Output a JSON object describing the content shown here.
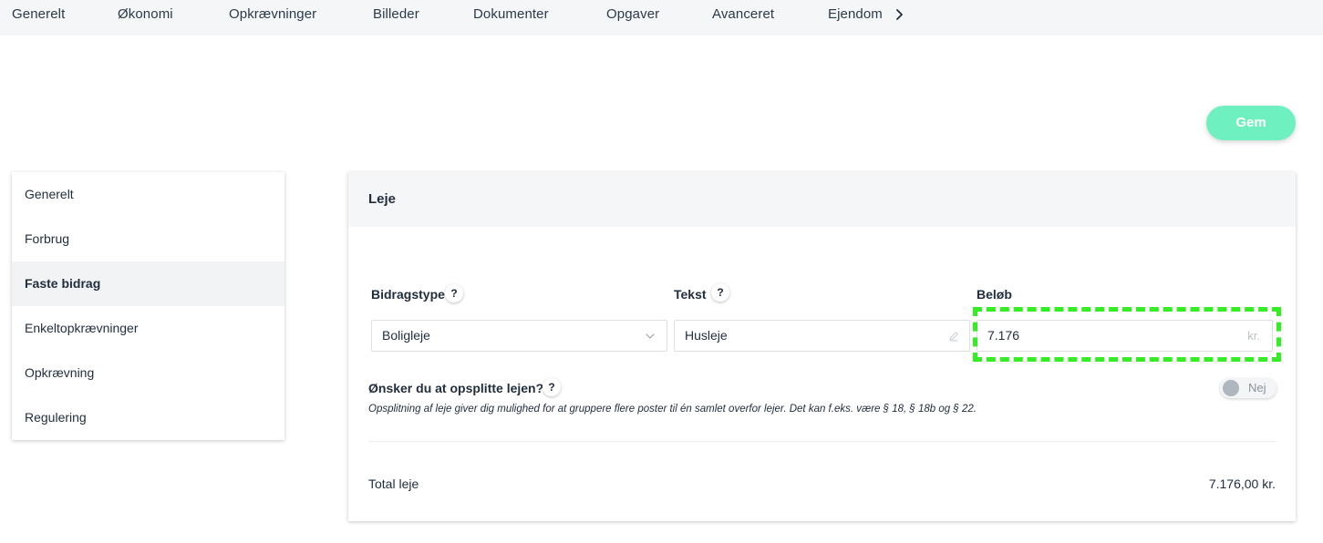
{
  "topnav": {
    "tabs": [
      "Generelt",
      "Økonomi",
      "Opkrævninger",
      "Billeder",
      "Dokumenter",
      "Opgaver",
      "Avanceret",
      "Ejendom"
    ],
    "more_icon": "chevron-right-icon"
  },
  "save_button": {
    "label": "Gem",
    "color": "#6ff0c0"
  },
  "sidebar": {
    "items": [
      {
        "label": "Generelt",
        "active": false
      },
      {
        "label": "Forbrug",
        "active": false
      },
      {
        "label": "Faste bidrag",
        "active": true
      },
      {
        "label": "Enkeltopkrævninger",
        "active": false
      },
      {
        "label": "Opkrævning",
        "active": false
      },
      {
        "label": "Regulering",
        "active": false
      }
    ]
  },
  "card": {
    "title": "Leje",
    "fields": {
      "type": {
        "label": "Bidragstype",
        "help": "?",
        "value": "Boligleje"
      },
      "text": {
        "label": "Tekst",
        "help": "?",
        "value": "Husleje"
      },
      "amount": {
        "label": "Beløb",
        "value": "7.176",
        "suffix": "kr."
      }
    },
    "split": {
      "question": "Ønsker du at opsplitte lejen?",
      "help": "?",
      "description": "Opsplitning af leje giver dig mulighed for at gruppere flere poster til én samlet overfor lejer. Det kan f.eks. være § 18, § 18b og § 22.",
      "toggle_label": "Nej",
      "toggle_on": false
    },
    "total": {
      "label": "Total leje",
      "value": "7.176,00 kr."
    }
  },
  "highlight_color": "#33ee22"
}
